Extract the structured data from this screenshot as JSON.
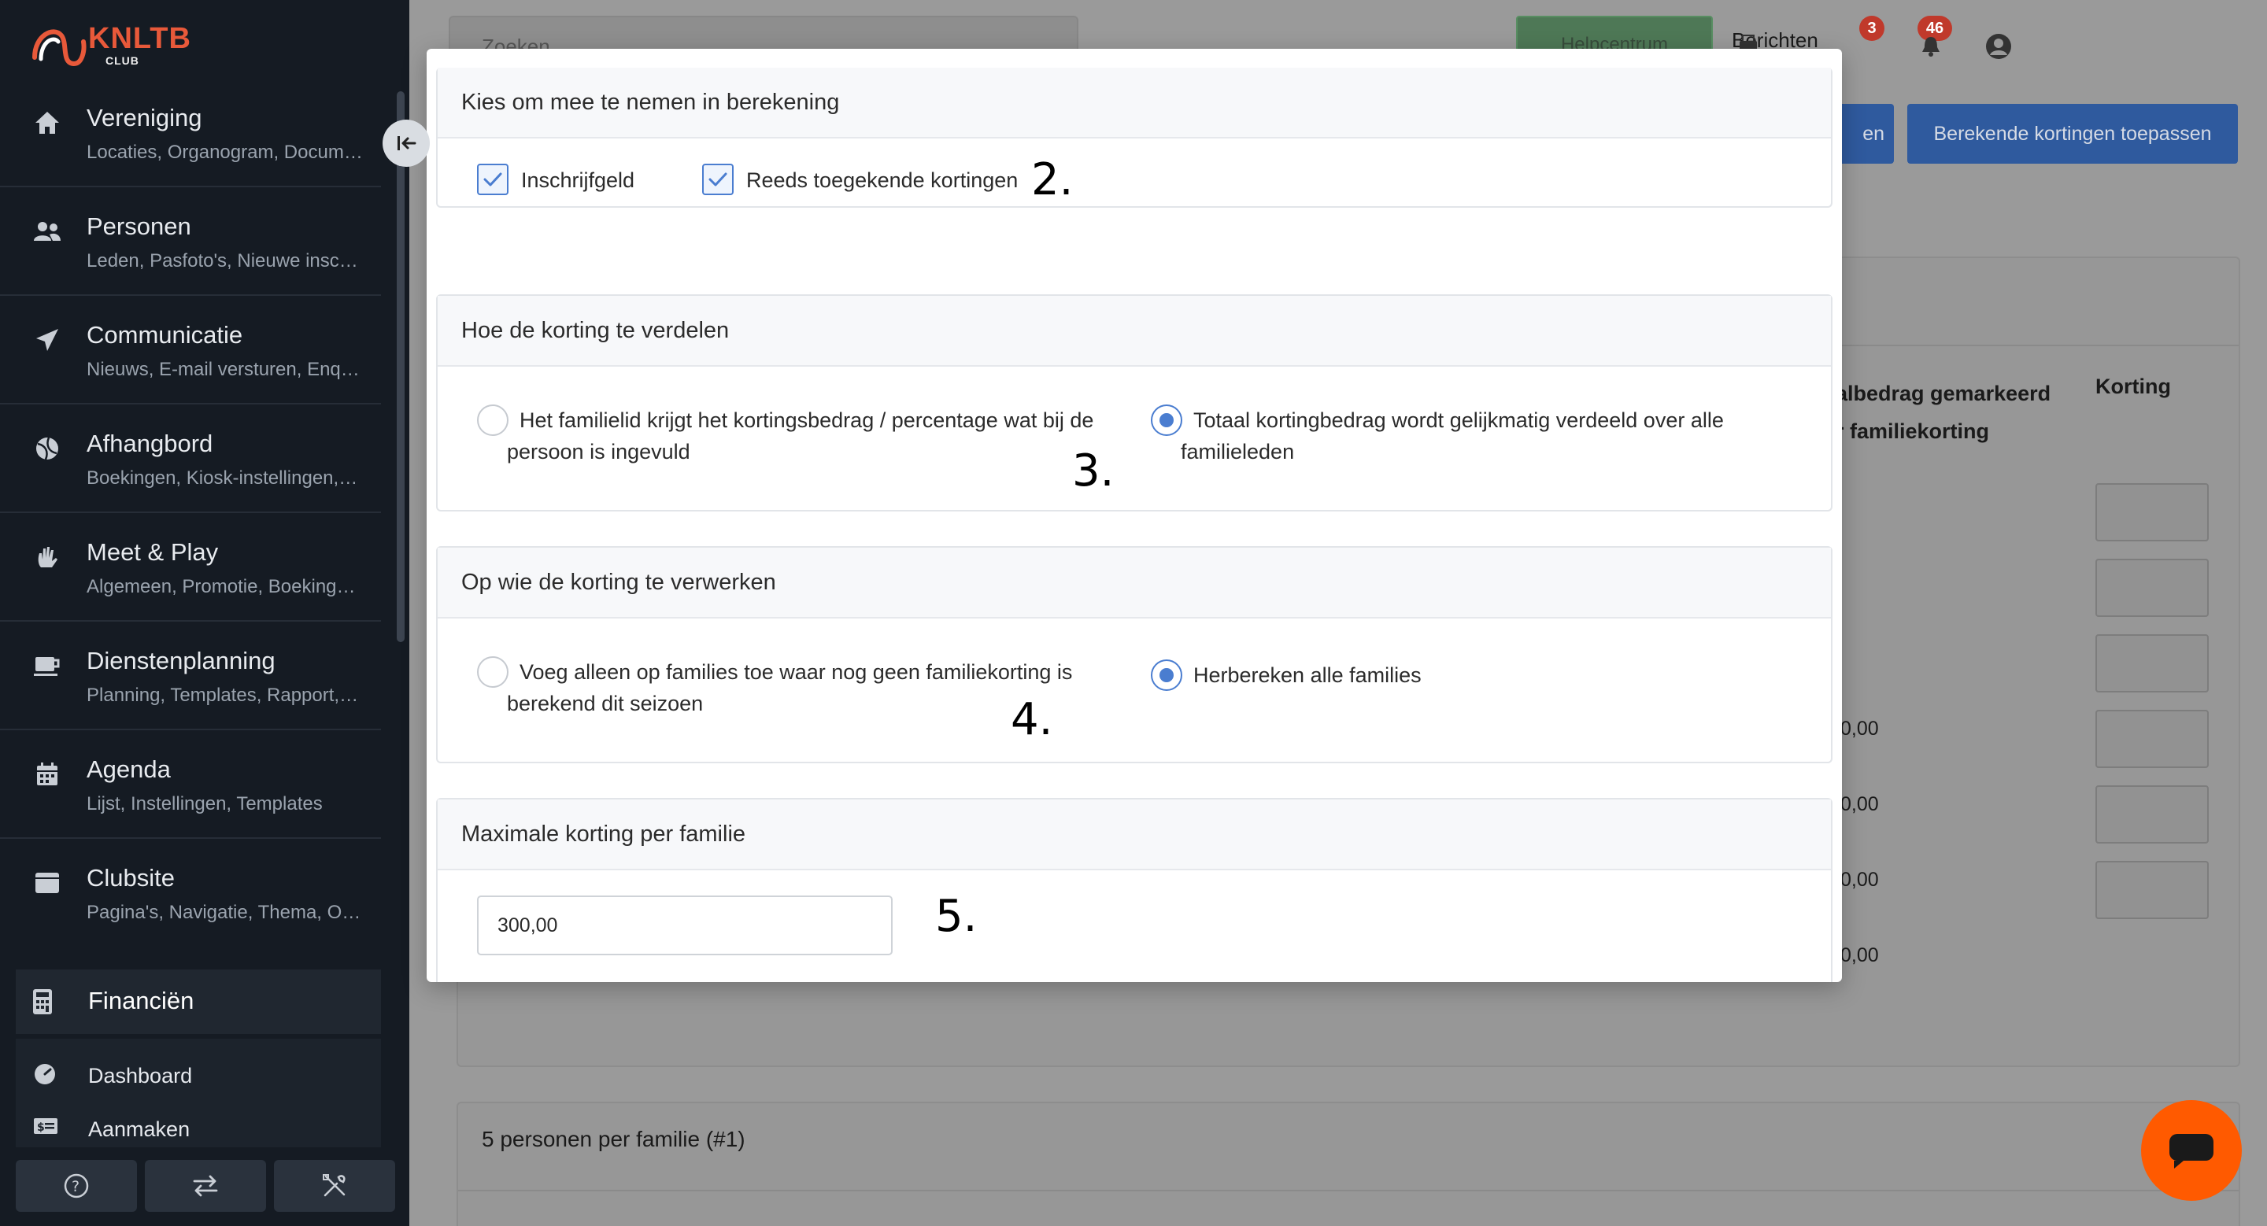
{
  "logo": {
    "title": "KNLTB",
    "sub": "CLUB"
  },
  "sidebar": {
    "items": [
      {
        "title": "Vereniging",
        "sub": "Locaties, Organogram, Docum…"
      },
      {
        "title": "Personen",
        "sub": "Leden, Pasfoto's, Nieuwe insc…"
      },
      {
        "title": "Communicatie",
        "sub": "Nieuws, E-mail versturen, Enq…"
      },
      {
        "title": "Afhangbord",
        "sub": "Boekingen, Kiosk-instellingen,…"
      },
      {
        "title": "Meet & Play",
        "sub": "Algemeen, Promotie, Boeking…"
      },
      {
        "title": "Dienstenplanning",
        "sub": "Planning, Templates, Rapport,…"
      },
      {
        "title": "Agenda",
        "sub": "Lijst, Instellingen, Templates"
      },
      {
        "title": "Clubsite",
        "sub": "Pagina's, Navigatie, Thema, O…"
      }
    ],
    "active": "Financiën",
    "subitems": [
      "Dashboard",
      "Aanmaken"
    ]
  },
  "topbar": {
    "search_placeholder": "Zoeken",
    "help_label": "Helpcentrum",
    "messages_label": "Berichten",
    "messages_badge": "3",
    "notifications_badge": "46"
  },
  "page": {
    "apply_button": "Berekende kortingen toepassen",
    "partial_button": "en",
    "col_header_1_line1": "albedrag gemarkeerd",
    "col_header_1_line2": "r familiekorting",
    "col_header_2": "Korting",
    "values": [
      "0,00",
      "0,00",
      "0,00",
      "0,00"
    ],
    "card2_title": "5 personen per familie (#1)"
  },
  "modal": {
    "section1": {
      "title": "Kies om mee te nemen in berekening",
      "checkbox1": "Inschrijfgeld",
      "checkbox2": "Reeds toegekende kortingen",
      "annotation": "2."
    },
    "section2": {
      "title": "Hoe de korting te verdelen",
      "option1_line1": "Het familielid krijgt het kortingsbedrag / percentage wat bij de",
      "option1_line2": "persoon is ingevuld",
      "option2_line1": "Totaal kortingbedrag wordt gelijkmatig verdeeld over alle",
      "option2_line2": "familieleden",
      "annotation": "3."
    },
    "section3": {
      "title": "Op wie de korting te verwerken",
      "option1_line1": "Voeg alleen op families toe waar nog geen familiekorting is",
      "option1_line2": "berekend dit seizoen",
      "option2": "Herbereken alle families",
      "annotation": "4."
    },
    "section4": {
      "title": "Maximale korting per familie",
      "value": "300,00",
      "annotation": "5."
    }
  },
  "colors": {
    "sidebar_bg": "#151b23",
    "accent_blue": "#4a7dd0",
    "brand_orange": "#e8593a",
    "chat_orange": "#ff5a00"
  }
}
